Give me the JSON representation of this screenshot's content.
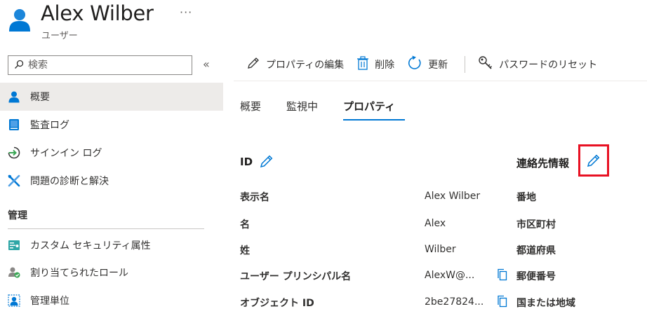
{
  "header": {
    "title": "Alex Wilber",
    "subtitle": "ユーザー",
    "more": "···"
  },
  "sidebar": {
    "search_placeholder": "検索",
    "collapse": "«",
    "items": [
      {
        "label": "概要",
        "icon": "user-icon",
        "active": true
      },
      {
        "label": "監査ログ",
        "icon": "book-icon"
      },
      {
        "label": "サインイン ログ",
        "icon": "sign-in-icon"
      },
      {
        "label": "問題の診断と解決",
        "icon": "wrench-icon"
      }
    ],
    "section": "管理",
    "manage_items": [
      {
        "label": "カスタム セキュリティ属性",
        "icon": "security-attribute-icon"
      },
      {
        "label": "割り当てられたロール",
        "icon": "roles-icon"
      },
      {
        "label": "管理単位",
        "icon": "admin-unit-icon"
      }
    ]
  },
  "toolbar": {
    "edit": "プロパティの編集",
    "delete": "削除",
    "refresh": "更新",
    "reset_password": "パスワードのリセット"
  },
  "tabs": [
    "概要",
    "監視中",
    "プロパティ"
  ],
  "identity": {
    "title": "ID",
    "rows": [
      {
        "label": "表示名",
        "value": "Alex Wilber"
      },
      {
        "label": "名",
        "value": "Alex"
      },
      {
        "label": "姓",
        "value": "Wilber"
      },
      {
        "label": "ユーザー プリンシパル名",
        "value": "AlexW@..."
      },
      {
        "label": "オブジェクト ID",
        "value": "2be27824..."
      }
    ]
  },
  "contact": {
    "title": "連絡先情報",
    "rows": [
      "番地",
      "市区町村",
      "都道府県",
      "郵便番号",
      "国または地域"
    ]
  },
  "colors": {
    "accent": "#0078d4",
    "highlight": "#e81123"
  }
}
